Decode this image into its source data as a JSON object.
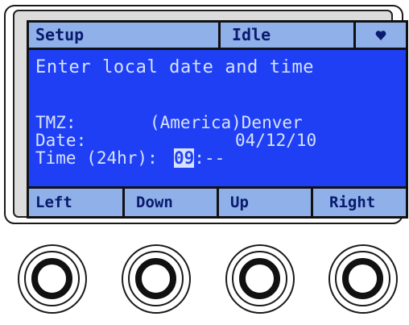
{
  "status_bar": {
    "mode": "Setup",
    "state": "Idle",
    "indicator_icon": "heart-icon"
  },
  "display": {
    "heading": "Enter local date and time",
    "tmz_label": "TMZ:",
    "tmz_value": "(America)Denver",
    "date_label": "Date:",
    "date_value": "04/12/10",
    "time_label": "Time (24hr):",
    "time_hours": "09",
    "time_rest": ":--"
  },
  "softkeys": {
    "left": "Left",
    "down": "Down",
    "up": "Up",
    "right": "Right"
  },
  "colors": {
    "screen_bg": "#1f3ff5",
    "bar_bg": "#8fb0e8",
    "text": "#d6e2ff"
  }
}
